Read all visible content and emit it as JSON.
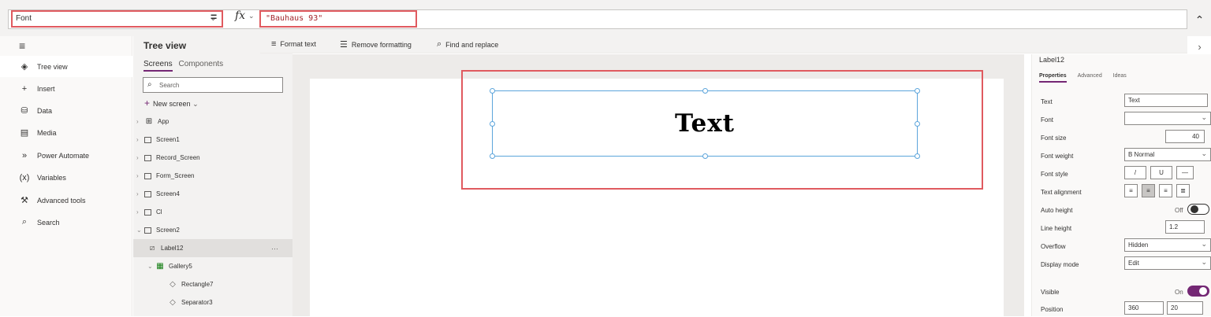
{
  "formula_bar": {
    "property": "Font",
    "equals": "=",
    "fx": "fx",
    "formula": "\"Bauhaus 93\""
  },
  "toolbar": {
    "format_text": "Format text",
    "remove_formatting": "Remove formatting",
    "find_replace": "Find and replace"
  },
  "left_nav": {
    "items": [
      {
        "label": "Tree view",
        "icon": "layers-icon"
      },
      {
        "label": "Insert",
        "icon": "plus-icon"
      },
      {
        "label": "Data",
        "icon": "database-icon"
      },
      {
        "label": "Media",
        "icon": "media-icon"
      },
      {
        "label": "Power Automate",
        "icon": "flow-icon"
      },
      {
        "label": "Variables",
        "icon": "variables-icon"
      },
      {
        "label": "Advanced tools",
        "icon": "tools-icon"
      },
      {
        "label": "Search",
        "icon": "search-icon"
      }
    ]
  },
  "tree": {
    "title": "Tree view",
    "tabs": [
      "Screens",
      "Components"
    ],
    "search_placeholder": "Search",
    "new_screen": "New screen",
    "rows": [
      "App",
      "Screen1",
      "Record_Screen",
      "Form_Screen",
      "Screen4",
      "Cl",
      "Screen2",
      "Label12",
      "Gallery5",
      "Rectangle7",
      "Separator3"
    ],
    "selected_dots": "···"
  },
  "canvas": {
    "label_text": "Text"
  },
  "properties": {
    "title": "Label12",
    "tabs": [
      "Properties",
      "Advanced",
      "Ideas"
    ],
    "text_label": "Text",
    "text_value": "Text",
    "font_label": "Font",
    "font_value": "",
    "font_size_label": "Font size",
    "font_size_value": "40",
    "font_weight_label": "Font weight",
    "font_weight_value": "B  Normal",
    "font_style_label": "Font style",
    "font_style_buttons": [
      "/",
      "U",
      "—"
    ],
    "text_alignment_label": "Text alignment",
    "auto_height_label": "Auto height",
    "auto_height_state": "Off",
    "line_height_label": "Line height",
    "line_height_value": "1.2",
    "overflow_label": "Overflow",
    "overflow_value": "Hidden",
    "display_mode_label": "Display mode",
    "display_mode_value": "Edit",
    "visible_label": "Visible",
    "visible_state": "On",
    "position_label": "Position",
    "position_x": "360",
    "position_y": "20"
  },
  "colors": {
    "highlight": "#e05a5f",
    "accent": "#742774",
    "selection": "#5ca5db"
  }
}
